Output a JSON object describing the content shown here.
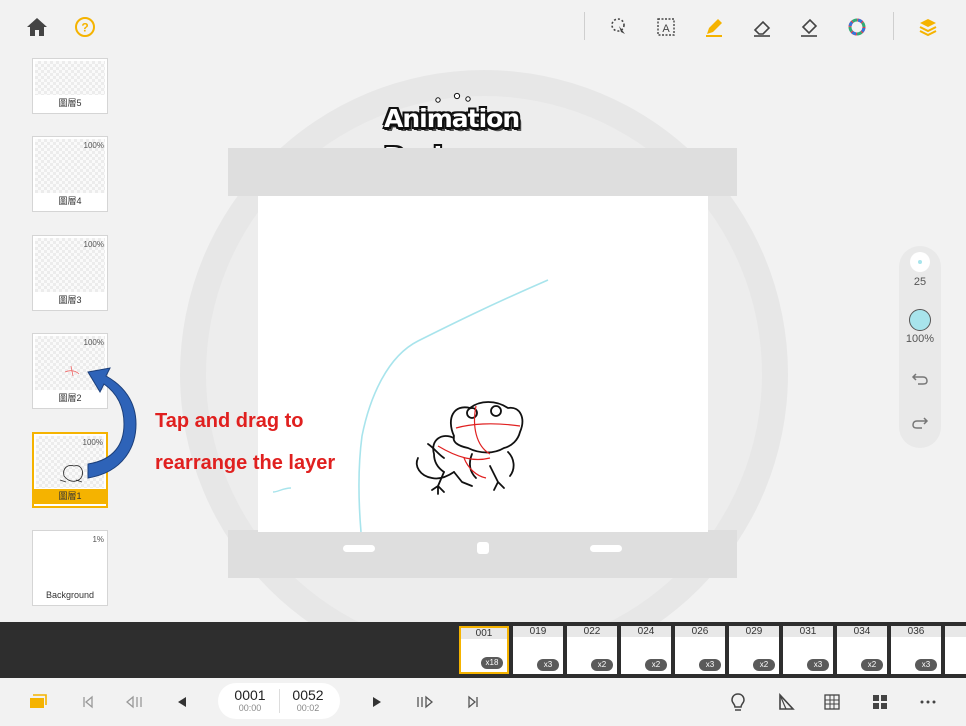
{
  "logo": {
    "text": "Animation Desk"
  },
  "layers": [
    {
      "name": "圖層5",
      "opacity": ""
    },
    {
      "name": "圖層4",
      "opacity": "100%"
    },
    {
      "name": "圖層3",
      "opacity": "100%"
    },
    {
      "name": "圖層2",
      "opacity": "100%"
    },
    {
      "name": "圖層1",
      "opacity": "100%"
    },
    {
      "name": "Background",
      "opacity": "1%"
    }
  ],
  "annotation": {
    "line1": "Tap and drag to",
    "line2": "rearrange the layer"
  },
  "brush": {
    "size": "25",
    "opacity": "100%"
  },
  "timeline": {
    "frames": [
      {
        "num": "001",
        "hold": "x18"
      },
      {
        "num": "019",
        "hold": "x3"
      },
      {
        "num": "022",
        "hold": "x2"
      },
      {
        "num": "024",
        "hold": "x2"
      },
      {
        "num": "026",
        "hold": "x3"
      },
      {
        "num": "029",
        "hold": "x2"
      },
      {
        "num": "031",
        "hold": "x3"
      },
      {
        "num": "034",
        "hold": "x2"
      },
      {
        "num": "036",
        "hold": "x3"
      }
    ]
  },
  "playback": {
    "current_frame": "0001",
    "current_time": "00:00",
    "total_frames": "0052",
    "total_time": "00:02"
  },
  "colors": {
    "accent": "#f5b300",
    "annotation": "#e0201f",
    "arrow": "#2e63b8",
    "brush": "#a8e4ec"
  }
}
